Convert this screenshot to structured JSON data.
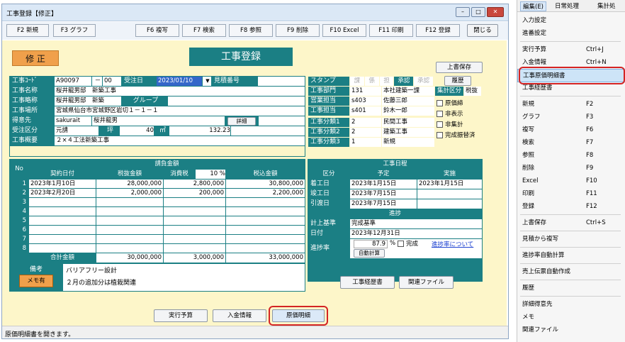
{
  "window": {
    "title": "工事登録【修正】",
    "btn_min": "–",
    "btn_max": "□",
    "btn_close": "✕"
  },
  "toolbar": {
    "keys": [
      "F2 新規",
      "F3 グラフ",
      "F6 複写",
      "F7 検索",
      "F8 参照",
      "F9 削除",
      "F10 Excel",
      "F11 印刷",
      "F12 登録"
    ],
    "close": "閉じる"
  },
  "header": {
    "mode": "修 正",
    "title": "工事登録",
    "save_top": "上書保存",
    "history": "履歴"
  },
  "form": {
    "code_lbl": "工事ｺｰﾄﾞ",
    "code": "A90097",
    "code_dash": "－",
    "code_no": "00",
    "order_date_lbl": "受注日",
    "order_date": "2023/01/10",
    "estimate_lbl": "見積番号",
    "name_lbl": "工事名称",
    "name": "桜井龍男邸　新築工事",
    "short_lbl": "工事略称",
    "short": "桜井龍男邸　新築",
    "group_lbl": "グループ",
    "place_lbl": "工事場所",
    "place": "宮城県仙台市宮城野区岩切１－１－１",
    "client_lbl": "得意先",
    "client_code": "sakurait",
    "client_name": "桜井龍男",
    "detail_btn": "詳細",
    "class_lbl": "受注区分",
    "class": "元請",
    "tsubo_lbl": "坪",
    "tsubo": "40",
    "m2_lbl": "㎡",
    "m2": "132.23",
    "summary_lbl": "工事概要",
    "summary": "２×４工法新築工事"
  },
  "stamp": {
    "lbl": "スタンプ",
    "items": [
      "課",
      "係",
      "担",
      "承認",
      "承認"
    ]
  },
  "right": {
    "dept_lbl": "工事部門",
    "dept_code": "131",
    "dept": "本社建築一課",
    "sales_lbl": "営業担当",
    "sales_code": "s403",
    "sales": "佐藤三郎",
    "mgr_lbl": "工事担当",
    "mgr_code": "s401",
    "mgr": "鈴木一郎",
    "c1_lbl": "工事分類1",
    "c1_code": "2",
    "c1": "民間工事",
    "c2_lbl": "工事分類2",
    "c2_code": "2",
    "c2": "建築工事",
    "c3_lbl": "工事分類3",
    "c3_code": "1",
    "c3": "新規",
    "agg_lbl": "集計区分",
    "exclude_lbl": "税抜",
    "agg_opts": [
      "原価締",
      "非表示",
      "非集計",
      "完成振替済"
    ]
  },
  "contract": {
    "title": "請負金額",
    "no_lbl": "No",
    "cols": [
      "契約日付",
      "税抜金額",
      "消費税",
      "税込金額"
    ],
    "tax_rate": "10 %",
    "rows": [
      [
        "1",
        "2023年1月10日",
        "28,000,000",
        "2,800,000",
        "30,800,000"
      ],
      [
        "2",
        "2023年2月20日",
        "2,000,000",
        "200,000",
        "2,200,000"
      ],
      [
        "3",
        "",
        "",
        "",
        ""
      ],
      [
        "4",
        "",
        "",
        "",
        ""
      ],
      [
        "5",
        "",
        "",
        "",
        ""
      ],
      [
        "6",
        "",
        "",
        "",
        ""
      ],
      [
        "7",
        "",
        "",
        "",
        ""
      ],
      [
        "8",
        "",
        "",
        "",
        ""
      ]
    ],
    "total_lbl": "合計金額",
    "total_ex": "30,000,000",
    "total_tax": "3,000,000",
    "total_in": "33,000,000"
  },
  "schedule": {
    "title": "工事日程",
    "cols": [
      "区分",
      "予定",
      "実施"
    ],
    "rows": [
      [
        "着工日",
        "2023年1月15日",
        "2023年1月15日"
      ],
      [
        "竣工日",
        "2023年7月15日",
        ""
      ],
      [
        "引渡日",
        "2023年7月15日",
        ""
      ]
    ]
  },
  "progress": {
    "title": "進捗",
    "basis_lbl": "計上基準",
    "basis": "完成基準",
    "date_lbl": "日付",
    "date": "2023年12月31日",
    "rate_lbl": "進捗率",
    "rate": "87.9",
    "pct": "%",
    "done_lbl": "完成",
    "link": "進捗率について",
    "auto_btn": "自動計算"
  },
  "notes": {
    "lbl": "備考",
    "memo_btn": "メモ有",
    "line1": "バリアフリー設計",
    "line2": "２月の追加分は植栽関連"
  },
  "bottom": {
    "history_btn": "工事経歴書",
    "file_btn": "関連ファイル",
    "budget_btn": "実行予算",
    "payment_btn": "入金情報",
    "cost_btn": "原価明細"
  },
  "statusbar": "原価明細書を開きます。",
  "menu": {
    "tabs": [
      "編集(E)",
      "日常処理",
      "集計処"
    ],
    "items": [
      [
        "入力設定",
        ""
      ],
      [
        "進番設定",
        ""
      ],
      [
        "SEP",
        ""
      ],
      [
        "実行予算",
        "Ctrl+J"
      ],
      [
        "入金情報",
        "Ctrl+N"
      ],
      [
        "工事原価明細書",
        ""
      ],
      [
        "工事経歴書",
        ""
      ],
      [
        "SEP",
        ""
      ],
      [
        "新規",
        "F2"
      ],
      [
        "グラフ",
        "F3"
      ],
      [
        "複写",
        "F6"
      ],
      [
        "検索",
        "F7"
      ],
      [
        "参照",
        "F8"
      ],
      [
        "削除",
        "F9"
      ],
      [
        "Excel",
        "F10"
      ],
      [
        "印刷",
        "F11"
      ],
      [
        "登録",
        "F12"
      ],
      [
        "SEP",
        ""
      ],
      [
        "上書保存",
        "Ctrl+S"
      ],
      [
        "SEP",
        ""
      ],
      [
        "見積から複写",
        ""
      ],
      [
        "SEP",
        ""
      ],
      [
        "進捗率自動計算",
        ""
      ],
      [
        "SEP",
        ""
      ],
      [
        "売上伝票自動作成",
        ""
      ],
      [
        "SEP",
        ""
      ],
      [
        "履歴",
        ""
      ],
      [
        "SEP",
        ""
      ],
      [
        "詳細得意先",
        ""
      ],
      [
        "メモ",
        ""
      ],
      [
        "関連ファイル",
        ""
      ]
    ]
  },
  "colors": {
    "teal": "#1b7f84",
    "yellow": "#fdf6c9",
    "highlight": "#cde4f7",
    "red": "#d42424"
  }
}
